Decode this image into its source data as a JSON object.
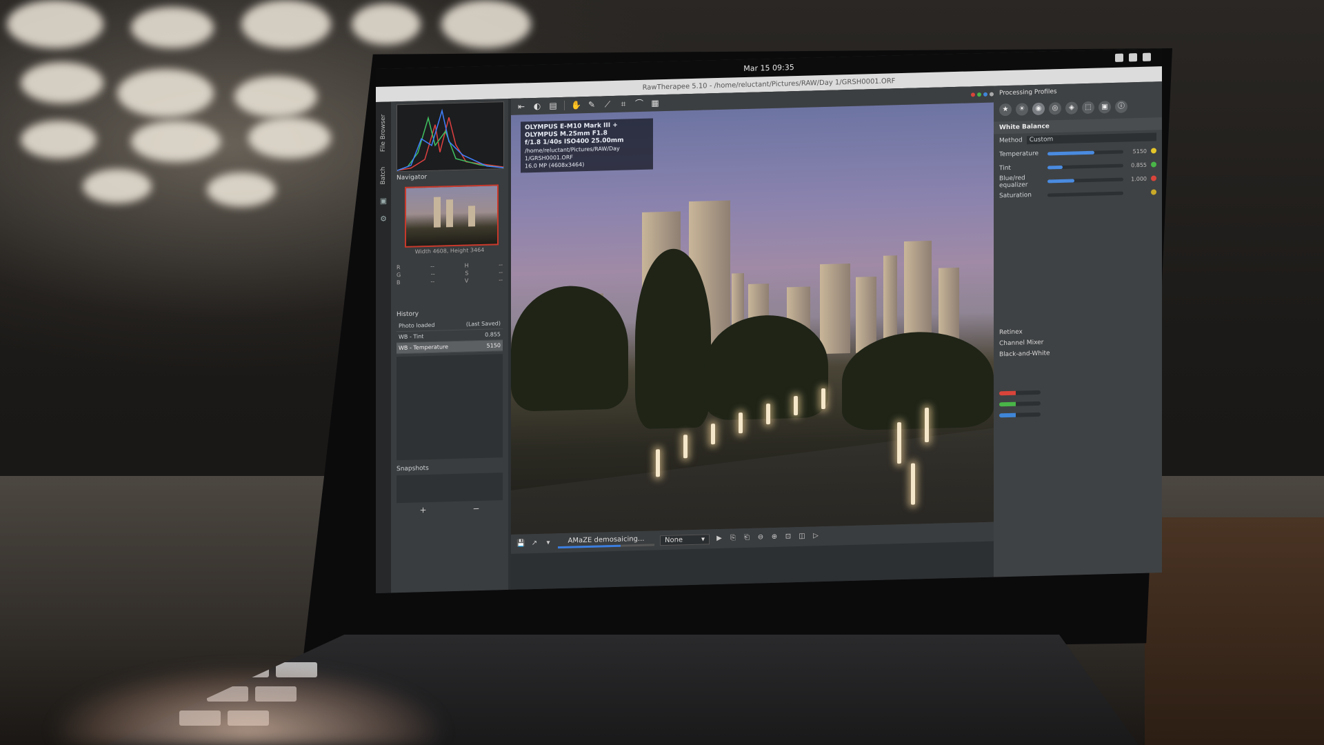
{
  "system": {
    "clock": "Mar 15  09:35"
  },
  "window": {
    "title": "RawTherapee 5.10 - /home/reluctant/Pictures/RAW/Day 1/GRSH0001.ORF"
  },
  "left_strip": {
    "labels": [
      "File Browser",
      "Batch"
    ]
  },
  "left_panel": {
    "navigator_title": "Navigator",
    "navigator_info": "Width 4608, Height 3464",
    "coords": [
      [
        "R",
        "--",
        "H",
        "--"
      ],
      [
        "G",
        "--",
        "S",
        "--"
      ],
      [
        "B",
        "--",
        "V",
        "--"
      ]
    ],
    "history_title": "History",
    "history_items": [
      {
        "label": "Photo loaded",
        "value": "(Last Saved)"
      },
      {
        "label": "WB - Tint",
        "value": "0.855"
      },
      {
        "label": "WB - Temperature",
        "value": "5150"
      }
    ],
    "snapshots_title": "Snapshots",
    "snapshot_add": "+",
    "snapshot_remove": "−"
  },
  "exif": {
    "camera": "OLYMPUS E-M10 Mark III + OLYMPUS M.25mm F1.8",
    "settings": "f/1.8  1/40s  ISO400  25.00mm",
    "path": "/home/reluctant/Pictures/RAW/Day 1/GRSH0001.ORF",
    "dims": "16.0 MP (4608x3464)"
  },
  "bottom_bar": {
    "status": "AMaZE demosaicing...",
    "progress": 0.65,
    "combo_value": "None"
  },
  "right_panel": {
    "header": "Processing Profiles",
    "section": "White Balance",
    "method_label": "Method",
    "method_value": "Custom",
    "collapsed": [
      "Retinex",
      "Channel Mixer",
      "Black-and-White"
    ],
    "sliders": [
      {
        "name": "Temperature",
        "fill": 0.62,
        "value": "5150",
        "color": "#e5c62a"
      },
      {
        "name": "Tint",
        "fill": 0.2,
        "value": "0.855",
        "color": "#49b548"
      },
      {
        "name": "Blue/red equalizer",
        "fill": 0.35,
        "value": "1.000",
        "color": "#d9443a"
      },
      {
        "name": "Saturation",
        "fill": 0.0,
        "value": "",
        "color": "#c9a928"
      }
    ],
    "rgb_rows": [
      {
        "color": "#d9443a",
        "fill": 0.4
      },
      {
        "color": "#49b548",
        "fill": 0.4
      },
      {
        "color": "#3f86d8",
        "fill": 0.4
      }
    ]
  },
  "colors": {
    "accent": "#3b7ee0",
    "selection": "#c8392b"
  }
}
